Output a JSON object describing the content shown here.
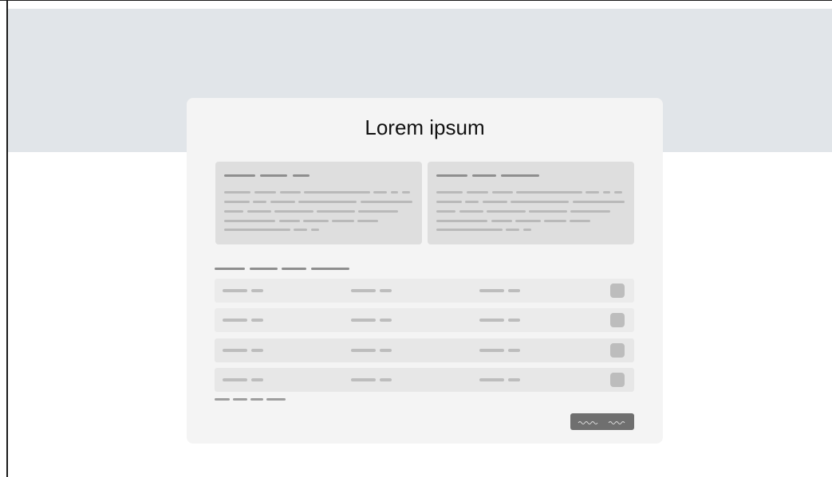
{
  "card": {
    "title": "Lorem ipsum"
  },
  "table": {
    "row_count": 4
  }
}
